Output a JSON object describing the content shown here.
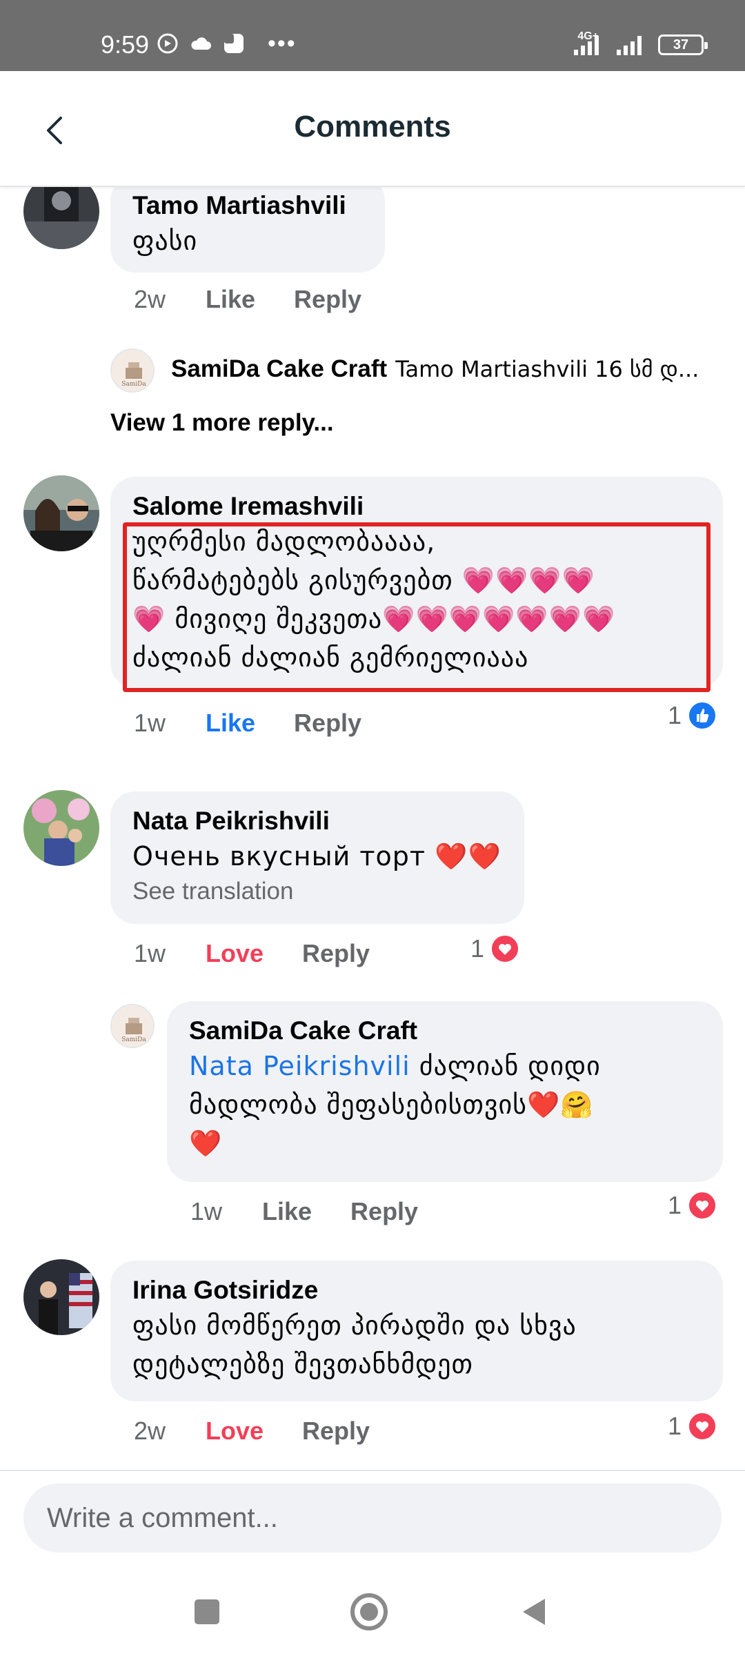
{
  "status_bar": {
    "time": "9:59",
    "network": "4G+",
    "battery": "37"
  },
  "header": {
    "title": "Comments"
  },
  "comments": [
    {
      "author": "Tamo Martiashvili",
      "text": "ფასი",
      "time": "2w",
      "like_label": "Like",
      "reply_label": "Reply"
    },
    {
      "reply_preview": {
        "author": "SamiDa Cake Craft",
        "text": "Tamo Martiashvili 16 სმ დ..."
      },
      "view_more": "View 1 more reply..."
    },
    {
      "author": "Salome Iremashvili",
      "lines": [
        "უღრმესი მადლობაააა,",
        "წარმატებებს გისურვებთ 💗💗💗💗",
        "💗 მივიღე შეკვეთა💗💗💗💗💗💗💗",
        "ძალიან ძალიან გემრიელიააა"
      ],
      "time": "1w",
      "like_label": "Like",
      "reply_label": "Reply",
      "reaction_count": "1"
    },
    {
      "author": "Nata Peikrishvili",
      "text": "Очень вкусный торт ❤️❤️",
      "see_translation": "See translation",
      "time": "1w",
      "love_label": "Love",
      "reply_label": "Reply",
      "reaction_count": "1"
    },
    {
      "author": "SamiDa Cake Craft",
      "mention": "Nata Peikrishvili",
      "line1": " ძალიან დიდი",
      "line2": "მადლობა შეფასებისთვის❤️🤗",
      "line3": "❤️",
      "time": "1w",
      "like_label": "Like",
      "reply_label": "Reply",
      "reaction_count": "1"
    },
    {
      "author": "Irina Gotsiridze",
      "line1": "ფასი  მომწერეთ პირადში და  სხვა",
      "line2": "დეტალებზე შევთანხმდეთ",
      "time": "2w",
      "love_label": "Love",
      "reply_label": "Reply",
      "reaction_count": "1"
    }
  ],
  "composer": {
    "placeholder": "Write a comment..."
  },
  "colors": {
    "status_bar": "#6e6e6e",
    "bubble": "#f0f2f5",
    "like_blue": "#1877f2",
    "love_red": "#f33e58",
    "highlight": "#e02424",
    "mention": "#1b74e4"
  }
}
